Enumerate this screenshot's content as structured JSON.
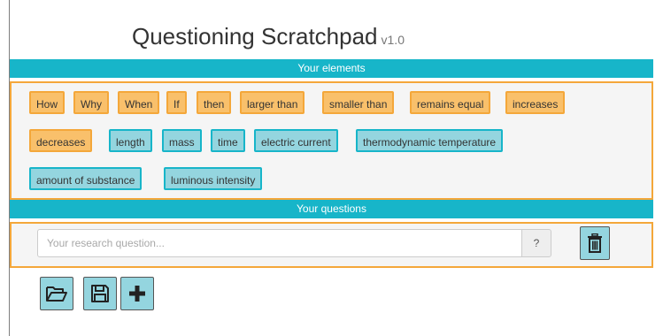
{
  "app": {
    "title": "Questioning Scratchpad",
    "version": "v1.0"
  },
  "elements_section": {
    "header": "Your elements",
    "chips": [
      {
        "label": "How",
        "kind": "orange"
      },
      {
        "label": "Why",
        "kind": "orange"
      },
      {
        "label": "When",
        "kind": "orange"
      },
      {
        "label": "If",
        "kind": "orange"
      },
      {
        "label": "then",
        "kind": "orange"
      },
      {
        "label": "larger than",
        "kind": "orange"
      },
      {
        "label": "smaller than",
        "kind": "orange"
      },
      {
        "label": "remains equal",
        "kind": "orange"
      },
      {
        "label": "increases",
        "kind": "orange"
      },
      {
        "label": "decreases",
        "kind": "orange"
      },
      {
        "label": "length",
        "kind": "blue"
      },
      {
        "label": "mass",
        "kind": "blue"
      },
      {
        "label": "time",
        "kind": "blue"
      },
      {
        "label": "electric current",
        "kind": "blue"
      },
      {
        "label": "thermodynamic temperature",
        "kind": "blue"
      },
      {
        "label": "amount of substance",
        "kind": "blue"
      },
      {
        "label": "luminous intensity",
        "kind": "blue"
      }
    ]
  },
  "questions_section": {
    "header": "Your questions",
    "input_value": "",
    "input_placeholder": "Your research question...",
    "help_label": "?"
  },
  "icons": {
    "trash": "trash-icon",
    "open": "folder-open-icon",
    "save": "floppy-disk-icon",
    "add": "plus-icon"
  },
  "colors": {
    "accent_teal": "#17b5c9",
    "chip_blue": "#94d5df",
    "chip_orange": "#f9c06b",
    "border_orange": "#f4a73a"
  }
}
